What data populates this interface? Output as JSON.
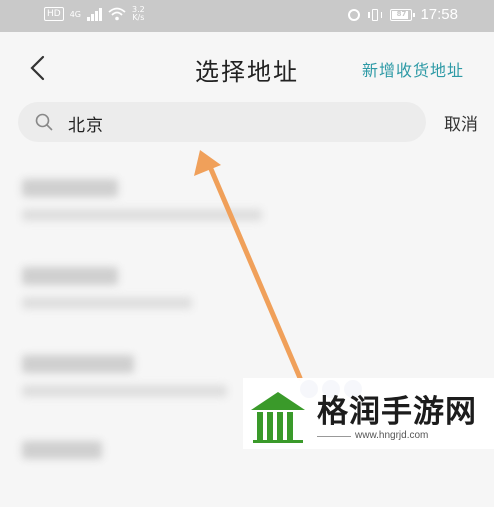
{
  "status_bar": {
    "hd": "HD",
    "network": "4G",
    "speed_value": "3.2",
    "speed_unit": "K/s",
    "battery": "87",
    "time": "17:58",
    "icons": [
      "signal-icon",
      "wifi-icon",
      "alarm-icon",
      "vibrate-icon",
      "battery-icon"
    ]
  },
  "header": {
    "back_icon": "chevron-left-icon",
    "title": "选择地址",
    "add_address": "新增收货地址"
  },
  "search": {
    "icon": "search-icon",
    "value": "北京",
    "cancel_label": "取消"
  },
  "results": [
    {
      "name": "",
      "address": ""
    },
    {
      "name": "",
      "address": ""
    },
    {
      "name": "",
      "address": ""
    },
    {
      "name": "",
      "address": ""
    }
  ],
  "watermark": {
    "name": "格润手游网",
    "url": "www.hngrjd.com"
  },
  "colors": {
    "accent": "#2e9aa6",
    "arrow": "#f0a05a",
    "status_bar": "#c9c9c9"
  }
}
